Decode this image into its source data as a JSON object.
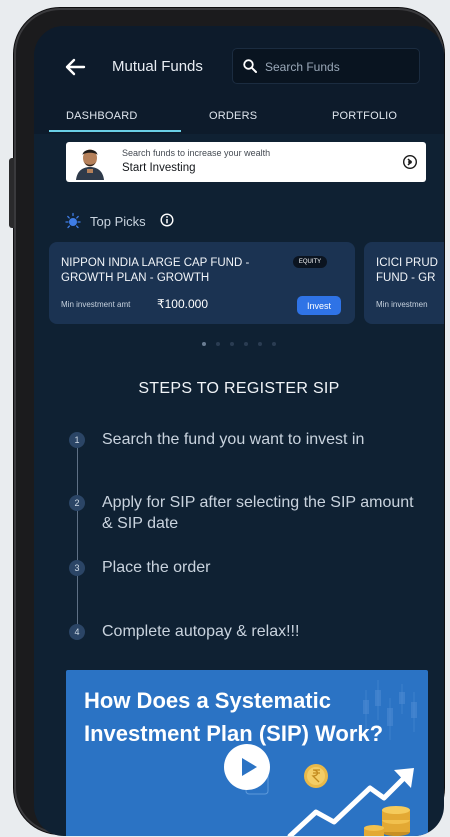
{
  "header": {
    "title": "Mutual Funds",
    "search_placeholder": "Search Funds"
  },
  "tabs": [
    {
      "label": "DASHBOARD",
      "active": true
    },
    {
      "label": "ORDERS",
      "active": false
    },
    {
      "label": "PORTFOLIO",
      "active": false
    }
  ],
  "promo": {
    "subtitle": "Search funds to increase your wealth",
    "title": "Start Investing"
  },
  "top_picks": {
    "label": "Top Picks",
    "cards": [
      {
        "name": "NIPPON INDIA LARGE CAP FUND - GROWTH PLAN - GROWTH",
        "badge": "EQUITY",
        "min_label": "Min investment amt",
        "min_value": "₹100.000",
        "invest_label": "Invest"
      },
      {
        "name": "ICICI PRUD FUND - GR",
        "min_label": "Min investmen"
      }
    ],
    "carousel_pages": 6,
    "carousel_active": 1
  },
  "steps": {
    "title": "STEPS TO REGISTER SIP",
    "items": [
      {
        "num": "1",
        "text": "Search the fund you want to invest in"
      },
      {
        "num": "2",
        "text": "Apply for SIP after selecting the SIP amount & SIP date"
      },
      {
        "num": "3",
        "text": "Place the order"
      },
      {
        "num": "4",
        "text": "Complete autopay & relax!!!"
      }
    ]
  },
  "video": {
    "title": "How Does a Systematic Investment Plan (SIP) Work?"
  },
  "colors": {
    "background": "#0f2133",
    "card": "#1b3352",
    "accent": "#6ad0e7",
    "invest_button": "#2f73e6",
    "video_card": "#2b73c4"
  },
  "icons": [
    "back-arrow-icon",
    "search-icon",
    "arrow-right-circle-icon",
    "bulb-icon",
    "info-icon",
    "play-icon"
  ]
}
